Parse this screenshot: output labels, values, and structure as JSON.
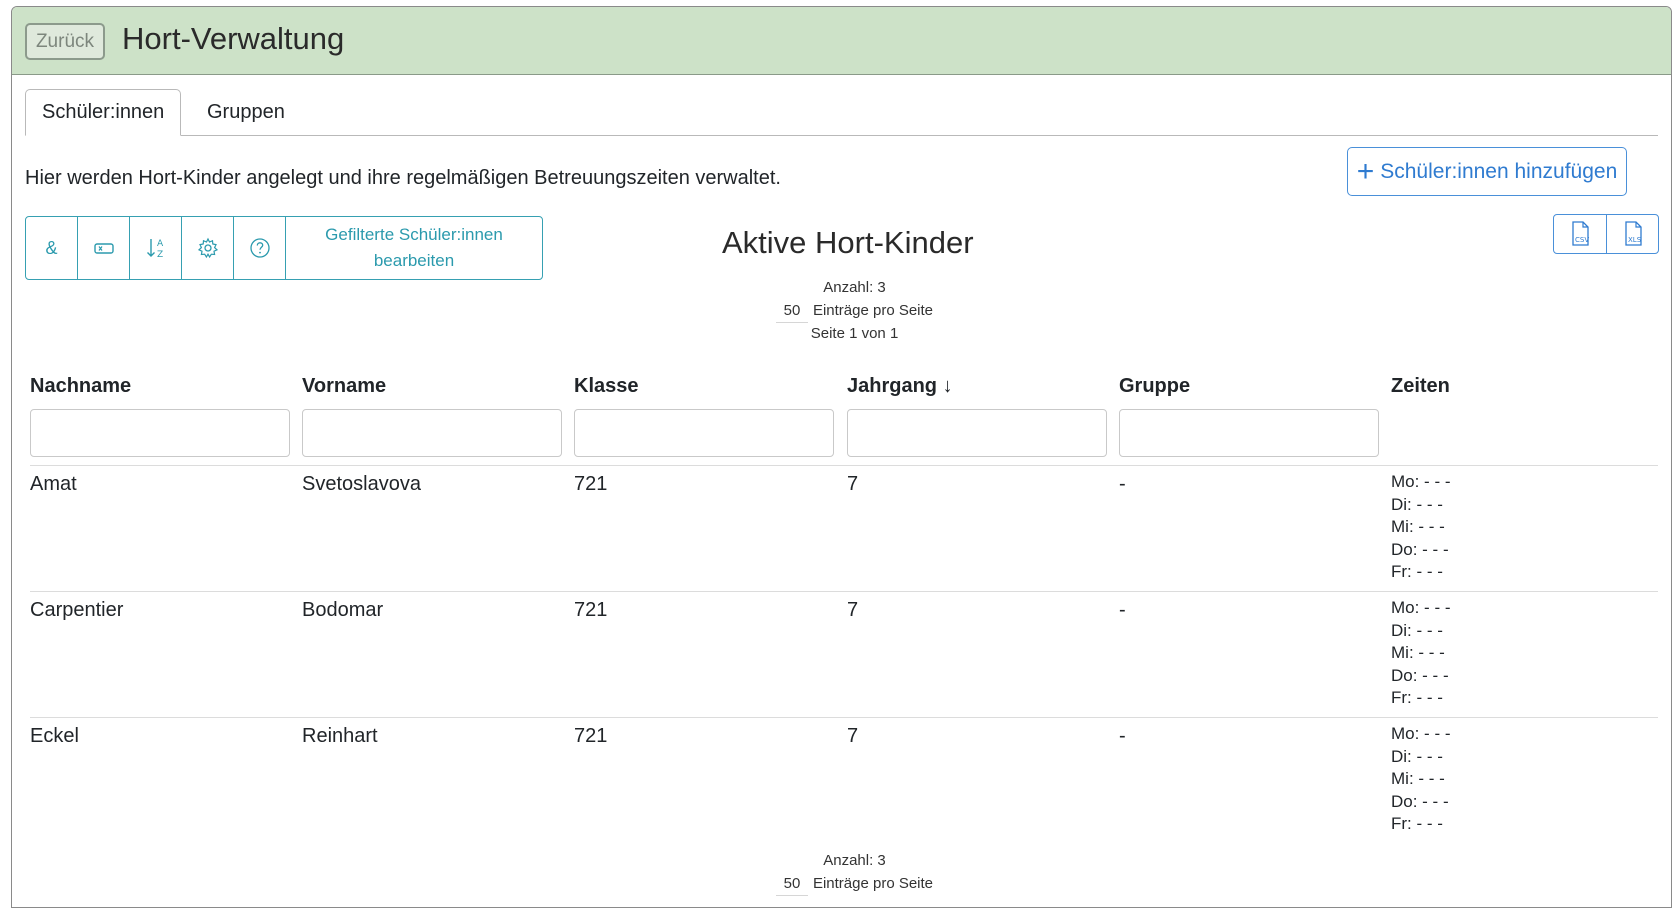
{
  "header": {
    "back_label": "Zurück",
    "title": "Hort-Verwaltung"
  },
  "tabs": [
    {
      "label": "Schüler:innen",
      "active": true
    },
    {
      "label": "Gruppen",
      "active": false
    }
  ],
  "description": "Hier werden Hort-Kinder angelegt und ihre regelmäßigen Betreuungszeiten verwaltet.",
  "add_button": {
    "label": "Schüler:innen hinzufügen",
    "icon": "plus-icon"
  },
  "toolbar": {
    "items": [
      {
        "glyph": "&",
        "icon": "ampersand-icon"
      },
      {
        "icon": "tag-icon"
      },
      {
        "icon": "sort-alpha-icon"
      },
      {
        "icon": "gear-icon"
      },
      {
        "icon": "help-icon"
      }
    ],
    "edit_filtered_label": "Gefilterte Schüler:innen bearbeiten"
  },
  "list_title": "Aktive Hort-Kinder",
  "export": [
    {
      "label": "CSV",
      "icon": "csv-file-icon"
    },
    {
      "label": "XLS",
      "icon": "xls-file-icon"
    }
  ],
  "pager": {
    "count": "Anzahl: 3",
    "per_page": "50",
    "per_page_label": "Einträge pro Seite",
    "page": "Seite 1 von 1"
  },
  "table": {
    "columns": [
      "Nachname",
      "Vorname",
      "Klasse",
      "Jahrgang ↓",
      "Gruppe",
      "Zeiten"
    ],
    "rows": [
      {
        "nachname": "Amat",
        "vorname": "Svetoslavova",
        "klasse": "721",
        "jahrgang": "7",
        "gruppe": "-",
        "zeiten": [
          "Mo: - - -",
          "Di: - - -",
          "Mi: - - -",
          "Do: - - -",
          "Fr: - - -"
        ]
      },
      {
        "nachname": "Carpentier",
        "vorname": "Bodomar",
        "klasse": "721",
        "jahrgang": "7",
        "gruppe": "-",
        "zeiten": [
          "Mo: - - -",
          "Di: - - -",
          "Mi: - - -",
          "Do: - - -",
          "Fr: - - -"
        ]
      },
      {
        "nachname": "Eckel",
        "vorname": "Reinhart",
        "klasse": "721",
        "jahrgang": "7",
        "gruppe": "-",
        "zeiten": [
          "Mo: - - -",
          "Di: - - -",
          "Mi: - - -",
          "Do: - - -",
          "Fr: - - -"
        ]
      }
    ]
  },
  "colors": {
    "header_bg": "#cde2c8",
    "accent_teal": "#2b9aad",
    "accent_blue": "#2f7bd0"
  }
}
